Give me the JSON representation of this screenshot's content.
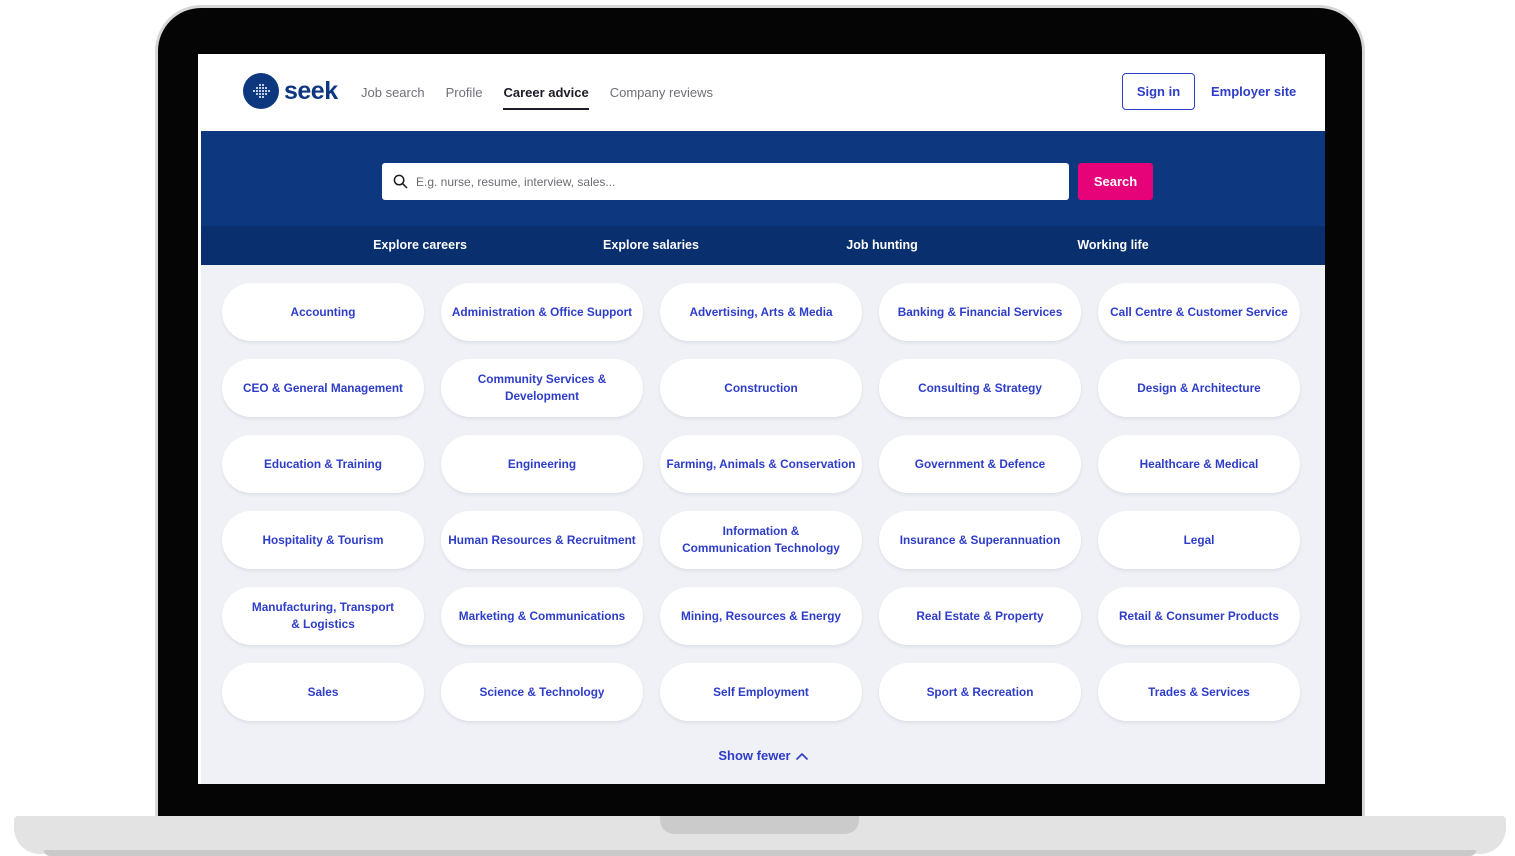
{
  "header": {
    "logo_text": "seek",
    "nav": [
      {
        "label": "Job search"
      },
      {
        "label": "Profile"
      },
      {
        "label": "Career advice",
        "active": true
      },
      {
        "label": "Company reviews"
      }
    ],
    "sign_in": "Sign in",
    "employer_site": "Employer site"
  },
  "search": {
    "placeholder": "E.g. nurse, resume, interview, sales...",
    "button": "Search"
  },
  "subnav": [
    {
      "label": "Explore careers"
    },
    {
      "label": "Explore salaries"
    },
    {
      "label": "Job hunting"
    },
    {
      "label": "Working life"
    }
  ],
  "categories": [
    "Accounting",
    "Administration & Office Support",
    "Advertising, Arts & Media",
    "Banking & Financial Services",
    "Call Centre & Customer Service",
    "CEO & General Management",
    "Community Services & Development",
    "Construction",
    "Consulting & Strategy",
    "Design & Architecture",
    "Education & Training",
    "Engineering",
    "Farming, Animals & Conservation",
    "Government & Defence",
    "Healthcare & Medical",
    "Hospitality & Tourism",
    "Human Resources & Recruitment",
    "Information & Communication Technology",
    "Insurance & Superannuation",
    "Legal",
    "Manufacturing, Transport & Logistics",
    "Marketing & Communications",
    "Mining, Resources & Energy",
    "Real Estate & Property",
    "Retail & Consumer Products",
    "Sales",
    "Science & Technology",
    "Self Employment",
    "Sport & Recreation",
    "Trades & Services"
  ],
  "show_fewer": "Show fewer",
  "colors": {
    "brand_navy": "#0d3880",
    "subnav_navy": "#0a2f6e",
    "link_blue": "#2e3dc8",
    "search_pink": "#e60278",
    "page_bg": "#eff1f6"
  },
  "icons": {
    "search": "search-icon",
    "show_fewer": "chevron-up-icon",
    "logo": "seek-logo-icon"
  }
}
